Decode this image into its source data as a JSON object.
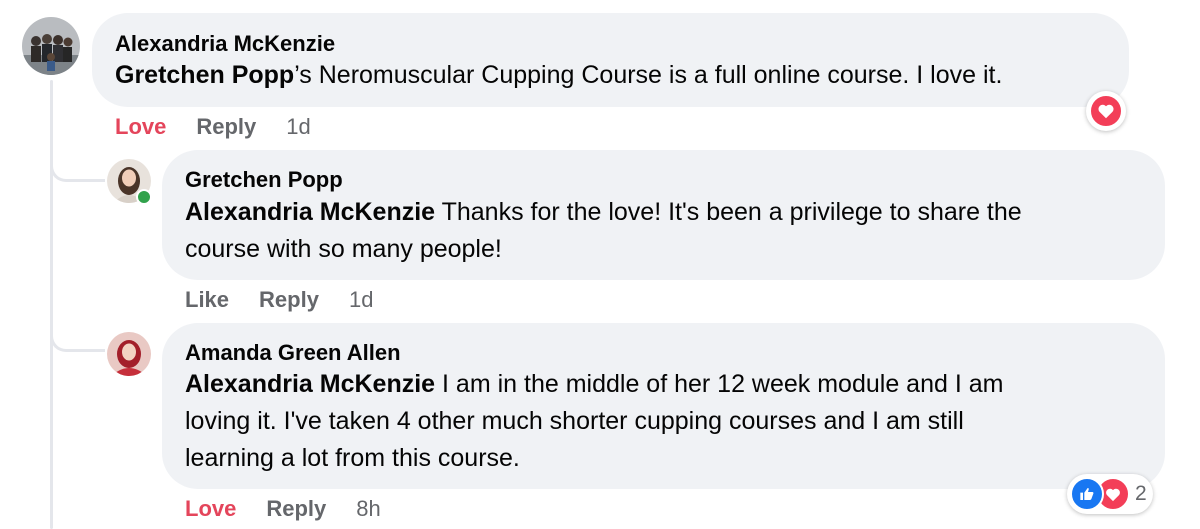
{
  "comments": [
    {
      "author": "Alexandria McKenzie",
      "mention": "Gretchen Popp",
      "body": "’s Neromuscular Cupping Course is a full online course. I love it.",
      "actions": {
        "reaction": "Love",
        "reply": "Reply",
        "time": "1d"
      },
      "reaction_icons": [
        "heart-icon"
      ]
    },
    {
      "author": "Gretchen Popp",
      "mention": "Alexandria McKenzie",
      "body_lines": [
        " Thanks for the love! It's been a privilege to share the",
        "course with so many people!"
      ],
      "actions": {
        "reaction": "Like",
        "reply": "Reply",
        "time": "1d"
      },
      "online": true
    },
    {
      "author": "Amanda Green Allen",
      "mention": "Alexandria McKenzie",
      "body_lines": [
        " I am in the middle of her 12 week module and I am",
        "loving it. I've taken 4 other much shorter cupping courses and I am still",
        "learning a lot from this course."
      ],
      "actions": {
        "reaction": "Love",
        "reply": "Reply",
        "time": "8h"
      },
      "reaction_icons": [
        "like-icon",
        "heart-icon"
      ],
      "reaction_count": "2"
    }
  ],
  "colors": {
    "bubble": "#f0f2f5",
    "love": "#e4455b",
    "like": "#1877f2",
    "muted": "#65676b",
    "online": "#31a24c"
  }
}
